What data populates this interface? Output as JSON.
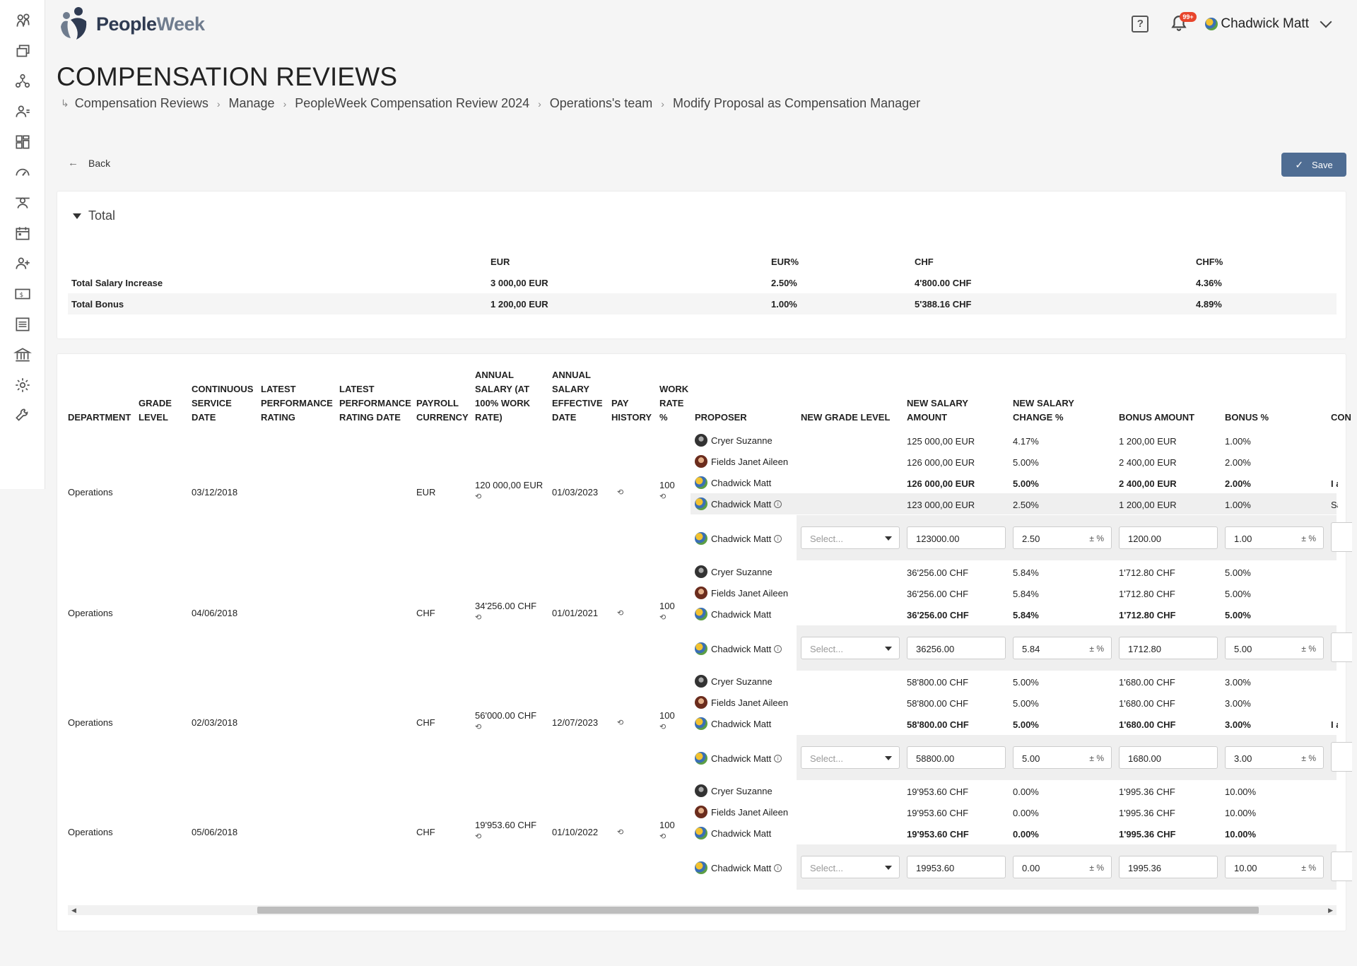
{
  "app": {
    "name_part1": "People",
    "name_part2": "Week"
  },
  "header": {
    "help_label": "?",
    "notifications_badge": "99+",
    "user_name": "Chadwick Matt"
  },
  "sidebar": {
    "items": [
      "team-icon",
      "copy-icon",
      "network-icon",
      "user-list-icon",
      "dashboard-icon",
      "speedometer-icon",
      "group-icon",
      "calendar-icon",
      "add-user-icon",
      "money-icon",
      "list-icon",
      "bank-icon",
      "settings-icon",
      "tools-icon"
    ]
  },
  "page": {
    "title": "COMPENSATION REVIEWS",
    "breadcrumb": [
      "Compensation Reviews",
      "Manage",
      "PeopleWeek Compensation Review 2024",
      "Operations's team",
      "Modify Proposal as Compensation Manager"
    ],
    "back_label": "Back",
    "save_label": "Save"
  },
  "totals": {
    "toggle_label": "Total",
    "headers": [
      "EUR",
      "EUR%",
      "CHF",
      "CHF%"
    ],
    "rows": [
      {
        "label": "Total Salary Increase",
        "eur": "3 000,00 EUR",
        "eur_pct": "2.50%",
        "chf": "4'800.00 CHF",
        "chf_pct": "4.36%"
      },
      {
        "label": "Total Bonus",
        "eur": "1 200,00 EUR",
        "eur_pct": "1.00%",
        "chf": "5'388.16 CHF",
        "chf_pct": "4.89%"
      }
    ]
  },
  "table": {
    "headers": {
      "department": "DEPARTMENT",
      "grade": [
        "GRADE",
        "LEVEL"
      ],
      "service": [
        "CONTINUOUS",
        "SERVICE",
        "DATE"
      ],
      "perf": [
        "LATEST",
        "PERFORMANCE",
        "RATING"
      ],
      "perf_date": [
        "LATEST",
        "PERFORMANCE",
        "RATING DATE"
      ],
      "currency": [
        "PAYROLL",
        "CURRENCY"
      ],
      "annual": [
        "ANNUAL",
        "SALARY (AT",
        "100% WORK",
        "RATE)"
      ],
      "eff_date": [
        "ANNUAL",
        "SALARY",
        "EFFECTIVE",
        "DATE"
      ],
      "pay_history": [
        "PAY",
        "HISTORY"
      ],
      "work_rate": [
        "WORK",
        "RATE",
        "%"
      ],
      "proposer": "PROPOSER",
      "new_grade": "NEW GRADE LEVEL",
      "new_salary": [
        "NEW SALARY",
        "AMOUNT"
      ],
      "new_change": [
        "NEW SALARY",
        "CHANGE %"
      ],
      "bonus_amount": "BONUS AMOUNT",
      "bonus_pct": "BONUS %",
      "comment": "CON"
    },
    "select_placeholder": "Select...",
    "pm_suffix": "± %",
    "history_glyph": "⟲",
    "info_glyph": "i",
    "employees": [
      {
        "department": "Operations",
        "service_date": "03/12/2018",
        "currency": "EUR",
        "annual_salary": "120 000,00 EUR",
        "effective_date": "01/03/2023",
        "work_rate": "100",
        "proposals": [
          {
            "name": "Cryer Suzanne",
            "avatar": "cs",
            "salary": "125 000,00 EUR",
            "change": "4.17%",
            "bonus": "1 200,00 EUR",
            "bonus_pct": "1.00%",
            "comment": "",
            "bold": false,
            "info": false
          },
          {
            "name": "Fields Janet Aileen",
            "avatar": "fj",
            "salary": "126 000,00 EUR",
            "change": "5.00%",
            "bonus": "2 400,00 EUR",
            "bonus_pct": "2.00%",
            "comment": "",
            "bold": false,
            "info": false
          },
          {
            "name": "Chadwick Matt",
            "avatar": "cm",
            "salary": "126 000,00 EUR",
            "change": "5.00%",
            "bonus": "2 400,00 EUR",
            "bonus_pct": "2.00%",
            "comment": "I ag",
            "bold": true,
            "info": false
          },
          {
            "name": "Chadwick Matt",
            "avatar": "cm",
            "salary": "123 000,00 EUR",
            "change": "2.50%",
            "bonus": "1 200,00 EUR",
            "bonus_pct": "1.00%",
            "comment": "Sala",
            "bold": false,
            "info": true,
            "shaded": true
          }
        ],
        "edit": {
          "name": "Chadwick Matt",
          "salary": "123000.00",
          "change": "2.50",
          "bonus": "1200.00",
          "bonus_pct": "1.00"
        }
      },
      {
        "department": "Operations",
        "service_date": "04/06/2018",
        "currency": "CHF",
        "annual_salary": "34'256.00 CHF",
        "effective_date": "01/01/2021",
        "work_rate": "100",
        "proposals": [
          {
            "name": "Cryer Suzanne",
            "avatar": "cs",
            "salary": "36'256.00 CHF",
            "change": "5.84%",
            "bonus": "1'712.80 CHF",
            "bonus_pct": "5.00%",
            "comment": "",
            "bold": false,
            "info": false
          },
          {
            "name": "Fields Janet Aileen",
            "avatar": "fj",
            "salary": "36'256.00 CHF",
            "change": "5.84%",
            "bonus": "1'712.80 CHF",
            "bonus_pct": "5.00%",
            "comment": "",
            "bold": false,
            "info": false
          },
          {
            "name": "Chadwick Matt",
            "avatar": "cm",
            "salary": "36'256.00 CHF",
            "change": "5.84%",
            "bonus": "1'712.80 CHF",
            "bonus_pct": "5.00%",
            "comment": "",
            "bold": true,
            "info": false
          }
        ],
        "edit": {
          "name": "Chadwick Matt",
          "salary": "36256.00",
          "change": "5.84",
          "bonus": "1712.80",
          "bonus_pct": "5.00"
        }
      },
      {
        "department": "Operations",
        "service_date": "02/03/2018",
        "currency": "CHF",
        "annual_salary": "56'000.00 CHF",
        "effective_date": "12/07/2023",
        "work_rate": "100",
        "proposals": [
          {
            "name": "Cryer Suzanne",
            "avatar": "cs",
            "salary": "58'800.00 CHF",
            "change": "5.00%",
            "bonus": "1'680.00 CHF",
            "bonus_pct": "3.00%",
            "comment": "",
            "bold": false,
            "info": false
          },
          {
            "name": "Fields Janet Aileen",
            "avatar": "fj",
            "salary": "58'800.00 CHF",
            "change": "5.00%",
            "bonus": "1'680.00 CHF",
            "bonus_pct": "3.00%",
            "comment": "",
            "bold": false,
            "info": false
          },
          {
            "name": "Chadwick Matt",
            "avatar": "cm",
            "salary": "58'800.00 CHF",
            "change": "5.00%",
            "bonus": "1'680.00 CHF",
            "bonus_pct": "3.00%",
            "comment": "I ag",
            "bold": true,
            "info": false
          }
        ],
        "edit": {
          "name": "Chadwick Matt",
          "salary": "58800.00",
          "change": "5.00",
          "bonus": "1680.00",
          "bonus_pct": "3.00"
        }
      },
      {
        "department": "Operations",
        "service_date": "05/06/2018",
        "currency": "CHF",
        "annual_salary": "19'953.60 CHF",
        "effective_date": "01/10/2022",
        "work_rate": "100",
        "proposals": [
          {
            "name": "Cryer Suzanne",
            "avatar": "cs",
            "salary": "19'953.60 CHF",
            "change": "0.00%",
            "bonus": "1'995.36 CHF",
            "bonus_pct": "10.00%",
            "comment": "",
            "bold": false,
            "info": false
          },
          {
            "name": "Fields Janet Aileen",
            "avatar": "fj",
            "salary": "19'953.60 CHF",
            "change": "0.00%",
            "bonus": "1'995.36 CHF",
            "bonus_pct": "10.00%",
            "comment": "",
            "bold": false,
            "info": false
          },
          {
            "name": "Chadwick Matt",
            "avatar": "cm",
            "salary": "19'953.60 CHF",
            "change": "0.00%",
            "bonus": "1'995.36 CHF",
            "bonus_pct": "10.00%",
            "comment": "",
            "bold": true,
            "info": false
          }
        ],
        "edit": {
          "name": "Chadwick Matt",
          "salary": "19953.60",
          "change": "0.00",
          "bonus": "1995.36",
          "bonus_pct": "10.00"
        }
      }
    ]
  },
  "colors": {
    "accent": "#4f6d93",
    "badge": "#e8452c"
  }
}
